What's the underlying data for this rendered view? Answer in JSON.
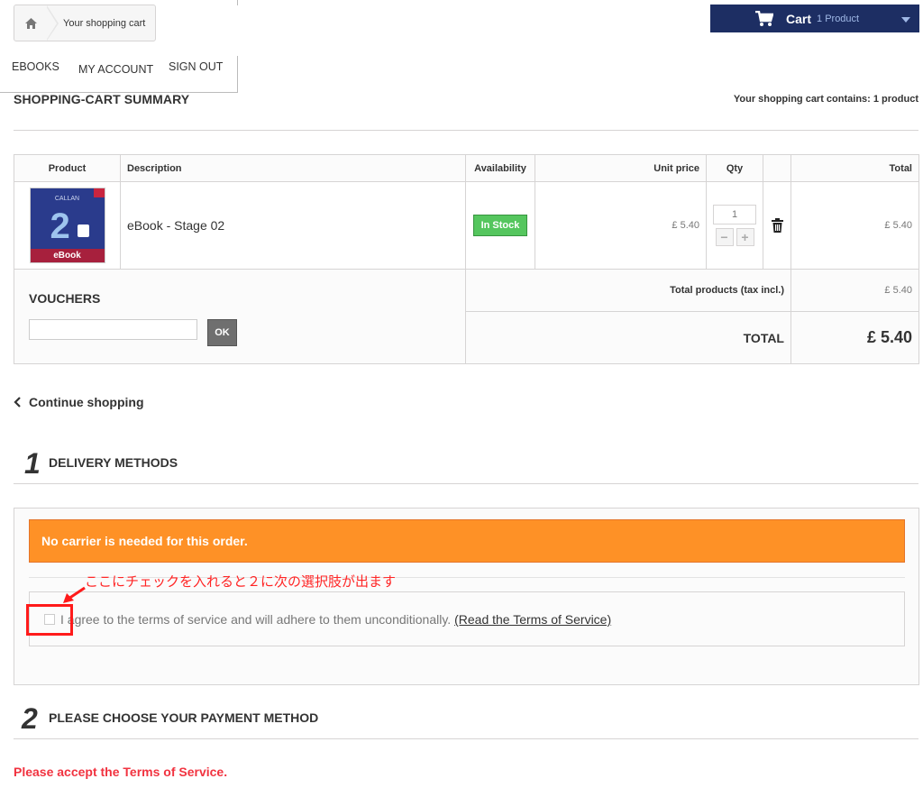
{
  "breadcrumb": {
    "current": "Your shopping cart"
  },
  "menu": {
    "items": [
      "EBOOKS",
      "MY ACCOUNT",
      "SIGN OUT"
    ]
  },
  "cart_button": {
    "label": "Cart",
    "count": "1 Product"
  },
  "summary": {
    "title": "SHOPPING-CART SUMMARY",
    "count_text": "Your shopping cart contains: 1 product"
  },
  "table": {
    "headers": {
      "product": "Product",
      "description": "Description",
      "availability": "Availability",
      "unit_price": "Unit price",
      "qty": "Qty",
      "total": "Total"
    },
    "items": [
      {
        "thumb_brand": "CALLAN",
        "thumb_number": "2",
        "thumb_label": "eBook",
        "description": "eBook - Stage 02",
        "availability": "In Stock",
        "unit_price": "£ 5.40",
        "qty": "1",
        "total": "£ 5.40"
      }
    ],
    "qty_minus": "−",
    "qty_plus": "+",
    "vouchers_title": "VOUCHERS",
    "voucher_ok": "OK",
    "total_products_label": "Total products (tax incl.)",
    "total_products_value": "£ 5.40",
    "grand_total_label": "TOTAL",
    "grand_total_value": "£ 5.40"
  },
  "continue_shopping": "Continue shopping",
  "step1": {
    "number": "1",
    "title": "DELIVERY METHODS"
  },
  "carrier_alert": "No carrier is needed for this order.",
  "tos": {
    "text": "I agree to the terms of service and will adhere to them unconditionally.",
    "link": "(Read the Terms of Service)",
    "checked": false
  },
  "annotation": {
    "text": "ここにチェックを入れると２に次の選択肢が出ます",
    "color": "#ff2525"
  },
  "step2": {
    "number": "2",
    "title": "PLEASE CHOOSE YOUR PAYMENT METHOD"
  },
  "terms_warning": "Please accept the Terms of Service.",
  "colors": {
    "cart_bg": "#1d2e63",
    "alert_orange": "#fe9126",
    "stock_green": "#55c65e",
    "warning_red": "#f13340"
  }
}
